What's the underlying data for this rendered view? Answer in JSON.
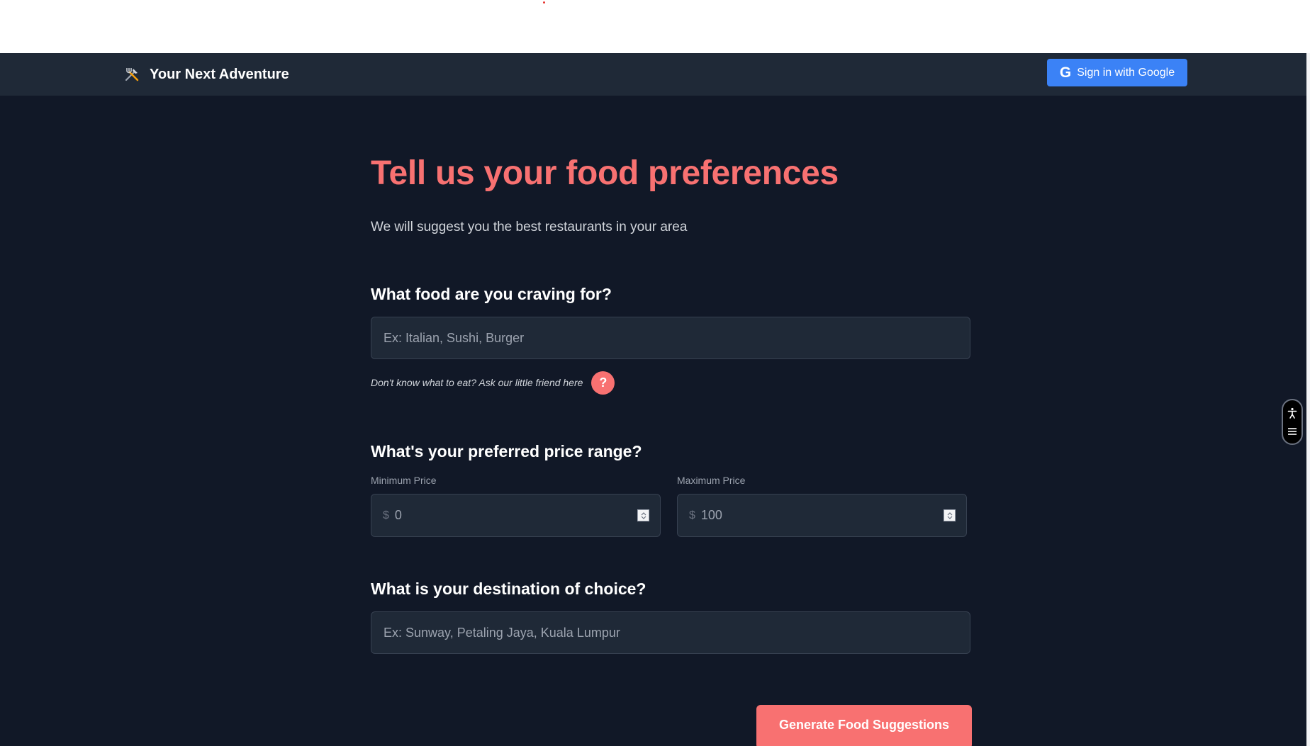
{
  "navbar": {
    "brand_icon": "utensils-icon",
    "brand_name": "Your Next Adventure",
    "signin_icon": "google-g-icon",
    "signin_icon_glyph": "G",
    "signin_label": "Sign in with Google"
  },
  "hero": {
    "title": "Tell us your food preferences",
    "subtitle": "We will suggest you the best restaurants in your area"
  },
  "craving": {
    "question": "What food are you craving for?",
    "placeholder": "Ex: Italian, Sushi, Burger",
    "helper_text": "Don't know what to eat? Ask our little friend here",
    "help_glyph": "?"
  },
  "price": {
    "question": "What's your preferred price range?",
    "min": {
      "label": "Minimum Price",
      "currency": "$",
      "value": "0"
    },
    "max": {
      "label": "Maximum Price",
      "currency": "$",
      "value": "100"
    }
  },
  "destination": {
    "question": "What is your destination of choice?",
    "placeholder": "Ex: Sunway, Petaling Jaya, Kuala Lumpur"
  },
  "actions": {
    "generate_label": "Generate Food Suggestions"
  },
  "widgets": {
    "accessibility_icon": "accessibility-icon",
    "menu_icon": "hamburger-menu-icon"
  },
  "colors": {
    "background": "#111827",
    "navbar": "#1f2937",
    "accent": "#f87171",
    "google_button": "#3b82f6"
  }
}
